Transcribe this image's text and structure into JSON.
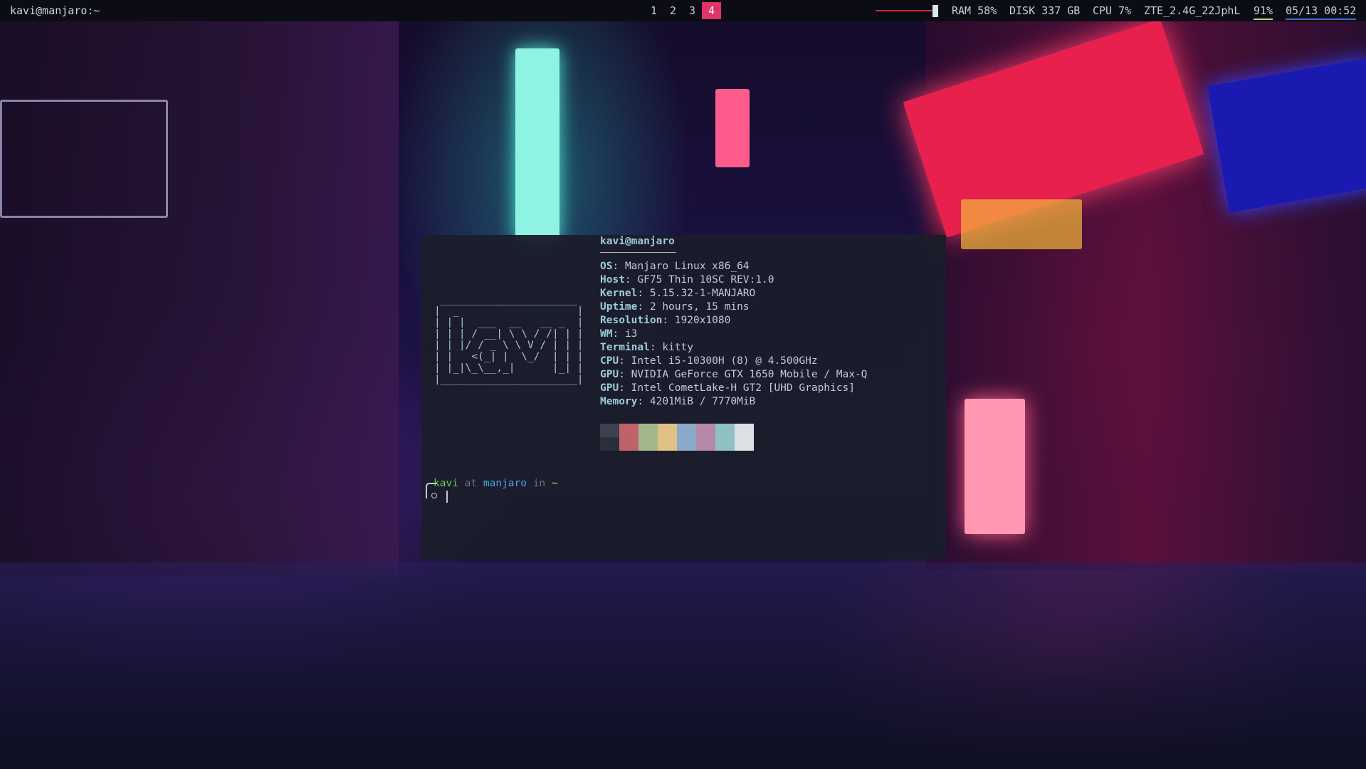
{
  "topbar": {
    "window_title": "kavi@manjaro:~",
    "workspaces": [
      "1",
      "2",
      "3",
      "4"
    ],
    "active_workspace": "4",
    "ram": "RAM 58%",
    "disk": "DISK 337 GB",
    "cpu": "CPU 7%",
    "network": "ZTE_2.4G_22JphL",
    "battery": "91%",
    "datetime": "05/13 00:52",
    "colors": {
      "active_workspace": "#e0336a",
      "volume": "#c43131",
      "battery_underline": "#b7d98b",
      "date_underline": "#3b73d6"
    }
  },
  "terminal": {
    "ascii_art": " ______________________\n|  _                   |\n| | |  ___  __   __ _  |\n| | | / __| \\ \\ / /| | |\n| | |/ / _ \\ \\ V / | | |\n| |   <(_| |  \\_/  | | |\n| |_|\\_\\__,_|      |_| |\n|______________________|",
    "header": "kavi@manjaro",
    "info": [
      {
        "key": "OS",
        "value": "Manjaro Linux x86_64"
      },
      {
        "key": "Host",
        "value": "GF75 Thin 10SC REV:1.0"
      },
      {
        "key": "Kernel",
        "value": "5.15.32-1-MANJARO"
      },
      {
        "key": "Uptime",
        "value": "2 hours, 15 mins"
      },
      {
        "key": "Resolution",
        "value": "1920x1080"
      },
      {
        "key": "WM",
        "value": "i3"
      },
      {
        "key": "Terminal",
        "value": "kitty"
      },
      {
        "key": "CPU",
        "value": "Intel i5-10300H (8) @ 4.500GHz"
      },
      {
        "key": "GPU",
        "value": "NVIDIA GeForce GTX 1650 Mobile / Max-Q"
      },
      {
        "key": "GPU",
        "value": "Intel CometLake-H GT2 [UHD Graphics]"
      },
      {
        "key": "Memory",
        "value": "4201MiB / 7770MiB"
      }
    ],
    "palette": [
      "#2b2f3a",
      "#c0626a",
      "#a3b88a",
      "#e0c184",
      "#8aa9c9",
      "#b68aa6",
      "#8ec1c1",
      "#dcdfe4"
    ],
    "palette_dark": "#3c4150",
    "prompt": {
      "user": "kavi",
      "at": "at",
      "host": "manjaro",
      "in": "in",
      "dir": "~"
    }
  }
}
